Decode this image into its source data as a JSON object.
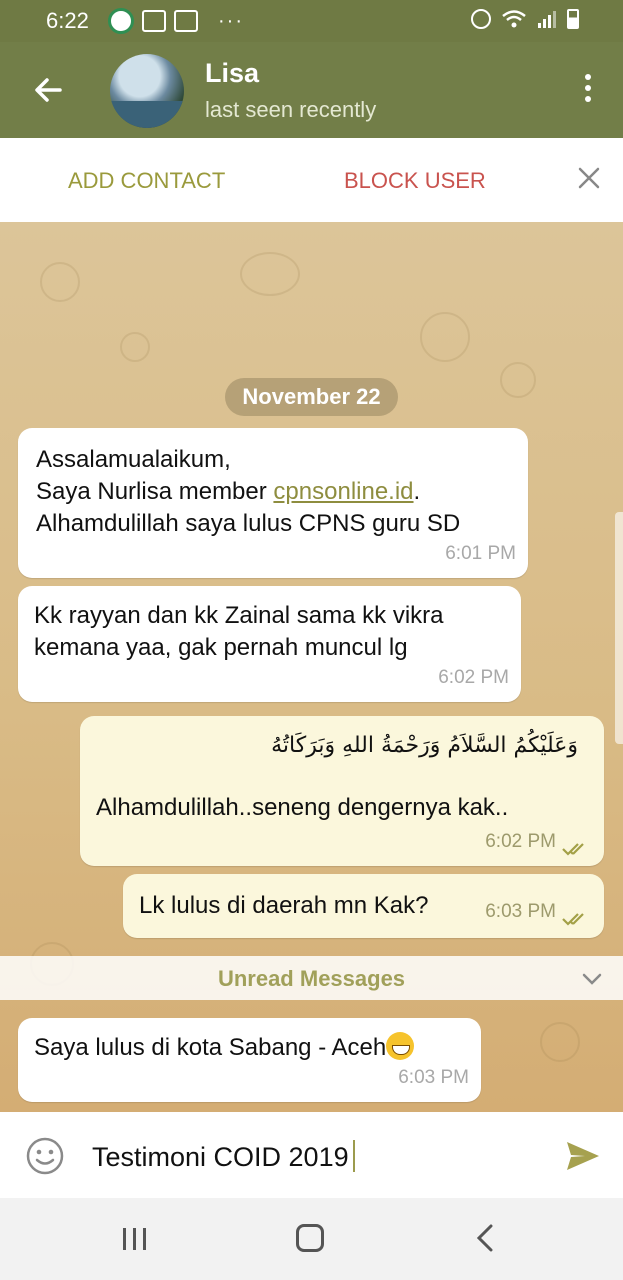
{
  "status_bar": {
    "time": "6:22",
    "overflow": "···",
    "left_icons": [
      "app-circle-icon",
      "gallery-icon",
      "gallery-icon"
    ],
    "right_icons": [
      "alarm-icon",
      "wifi-icon",
      "signal-icon",
      "battery-icon"
    ]
  },
  "header": {
    "name": "Lisa",
    "status": "last seen recently",
    "back_icon": "arrow-left-icon",
    "menu_icon": "more-vert-icon"
  },
  "actions": {
    "add_contact": "ADD CONTACT",
    "block_user": "BLOCK USER",
    "close_icon": "close-icon"
  },
  "chat": {
    "date": "November 22",
    "messages": [
      {
        "direction": "incoming",
        "line1": "Assalamualaikum,",
        "line2_before": "Saya Nurlisa member ",
        "line2_link": "cpnsonline.id",
        "line2_after": ".",
        "line3": "Alhamdulillah saya lulus CPNS guru SD",
        "time": "6:01 PM"
      },
      {
        "direction": "incoming",
        "line1": "Kk rayyan dan kk Zainal sama kk vikra",
        "line2": "kemana yaa, gak pernah muncul lg",
        "time": "6:02 PM"
      },
      {
        "direction": "outgoing",
        "arabic": "وَعَلَيْكُمُ السَّلاَمُ وَرَحْمَةُ اللهِ وَبَرَكَاتُهُ",
        "text": "Alhamdulillah..seneng dengernya kak..",
        "time": "6:02 PM",
        "read": true
      },
      {
        "direction": "outgoing",
        "text": "Lk lulus di daerah mn Kak?",
        "time": "6:03 PM",
        "read": true
      },
      {
        "direction": "incoming",
        "text": "Saya lulus di kota Sabang - Aceh",
        "emoji": "grinning-face-icon",
        "time": "6:03 PM"
      }
    ],
    "unread_label": "Unread Messages"
  },
  "composer": {
    "text": "Testimoni COID 2019",
    "emoji_icon": "smiley-icon",
    "send_icon": "send-icon"
  },
  "colors": {
    "header": "#727e48",
    "accent": "#9a9a3c",
    "danger": "#c9534e",
    "outgoing_bubble": "#fbf7dc"
  }
}
